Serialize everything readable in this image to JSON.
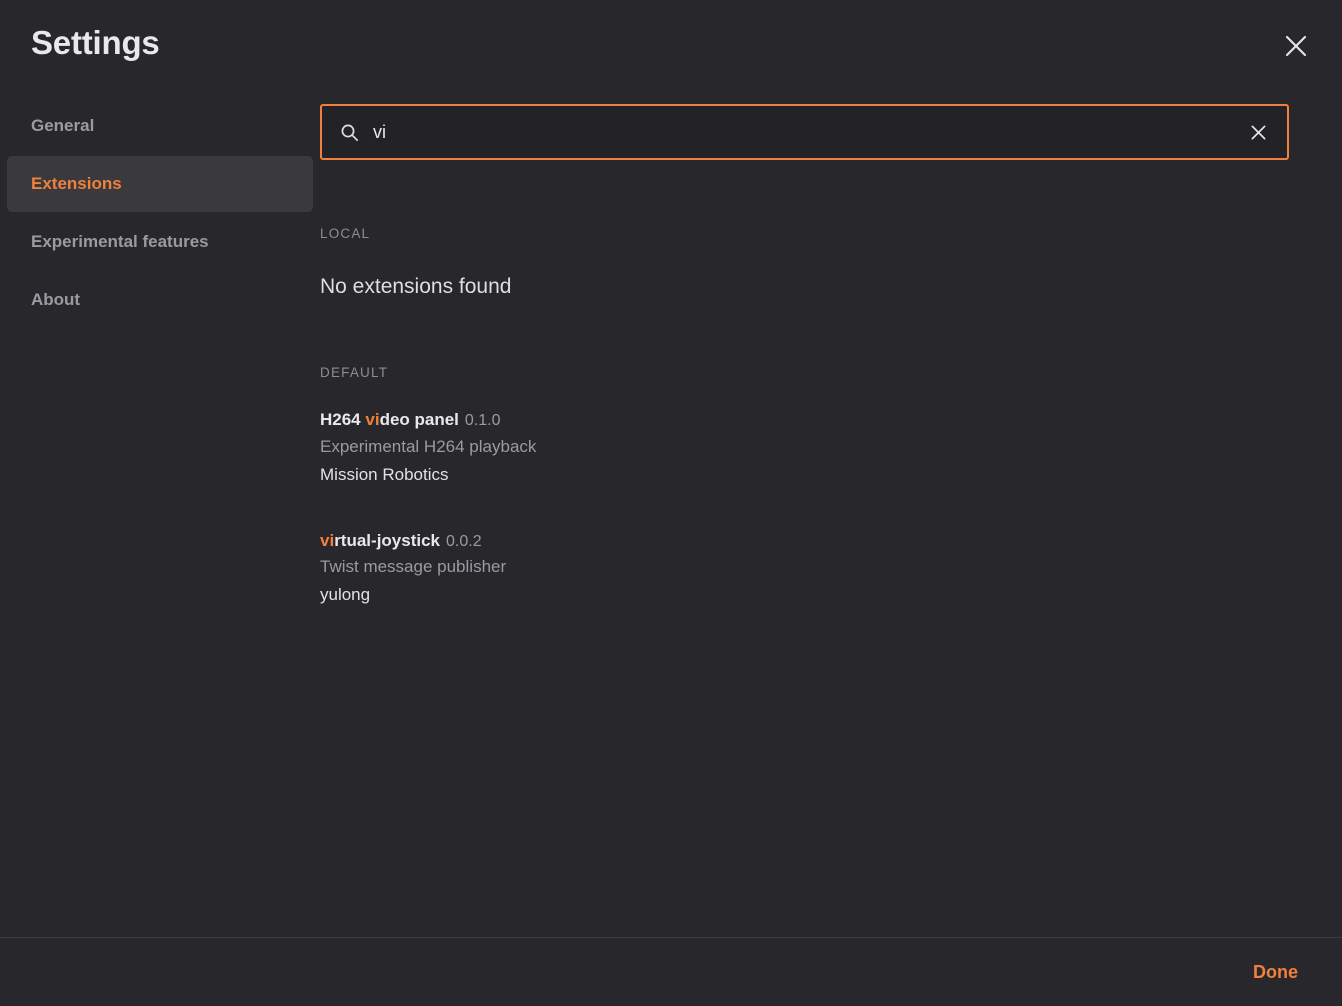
{
  "window": {
    "title": "Settings",
    "close_icon": "close-icon"
  },
  "colors": {
    "accent": "#f0803c",
    "background": "#28282c",
    "selected_item_bg": "#3a3a3e",
    "input_bg": "#232327",
    "text_primary": "#e9e9eb",
    "text_muted": "#9a9aa0",
    "divider": "#3d3d42"
  },
  "sidebar": {
    "items": [
      {
        "label": "General",
        "selected": false
      },
      {
        "label": "Extensions",
        "selected": true
      },
      {
        "label": "Experimental features",
        "selected": false
      },
      {
        "label": "About",
        "selected": false
      }
    ]
  },
  "search": {
    "value": "vi",
    "placeholder": "Search",
    "search_icon": "search-icon",
    "clear_icon": "clear-icon"
  },
  "sections": [
    {
      "header": "LOCAL",
      "empty_message": "No extensions found",
      "extensions": []
    },
    {
      "header": "DEFAULT",
      "empty_message": "",
      "extensions": [
        {
          "name_pre": "H264 ",
          "name_match": "vi",
          "name_post": "deo panel",
          "version": "0.1.0",
          "description": "Experimental H264 playback",
          "publisher": "Mission Robotics"
        },
        {
          "name_pre": "",
          "name_match": "vi",
          "name_post": "rtual-joystick",
          "version": "0.0.2",
          "description": "Twist message publisher",
          "publisher": "yulong"
        }
      ]
    }
  ],
  "footer": {
    "done_label": "Done"
  }
}
